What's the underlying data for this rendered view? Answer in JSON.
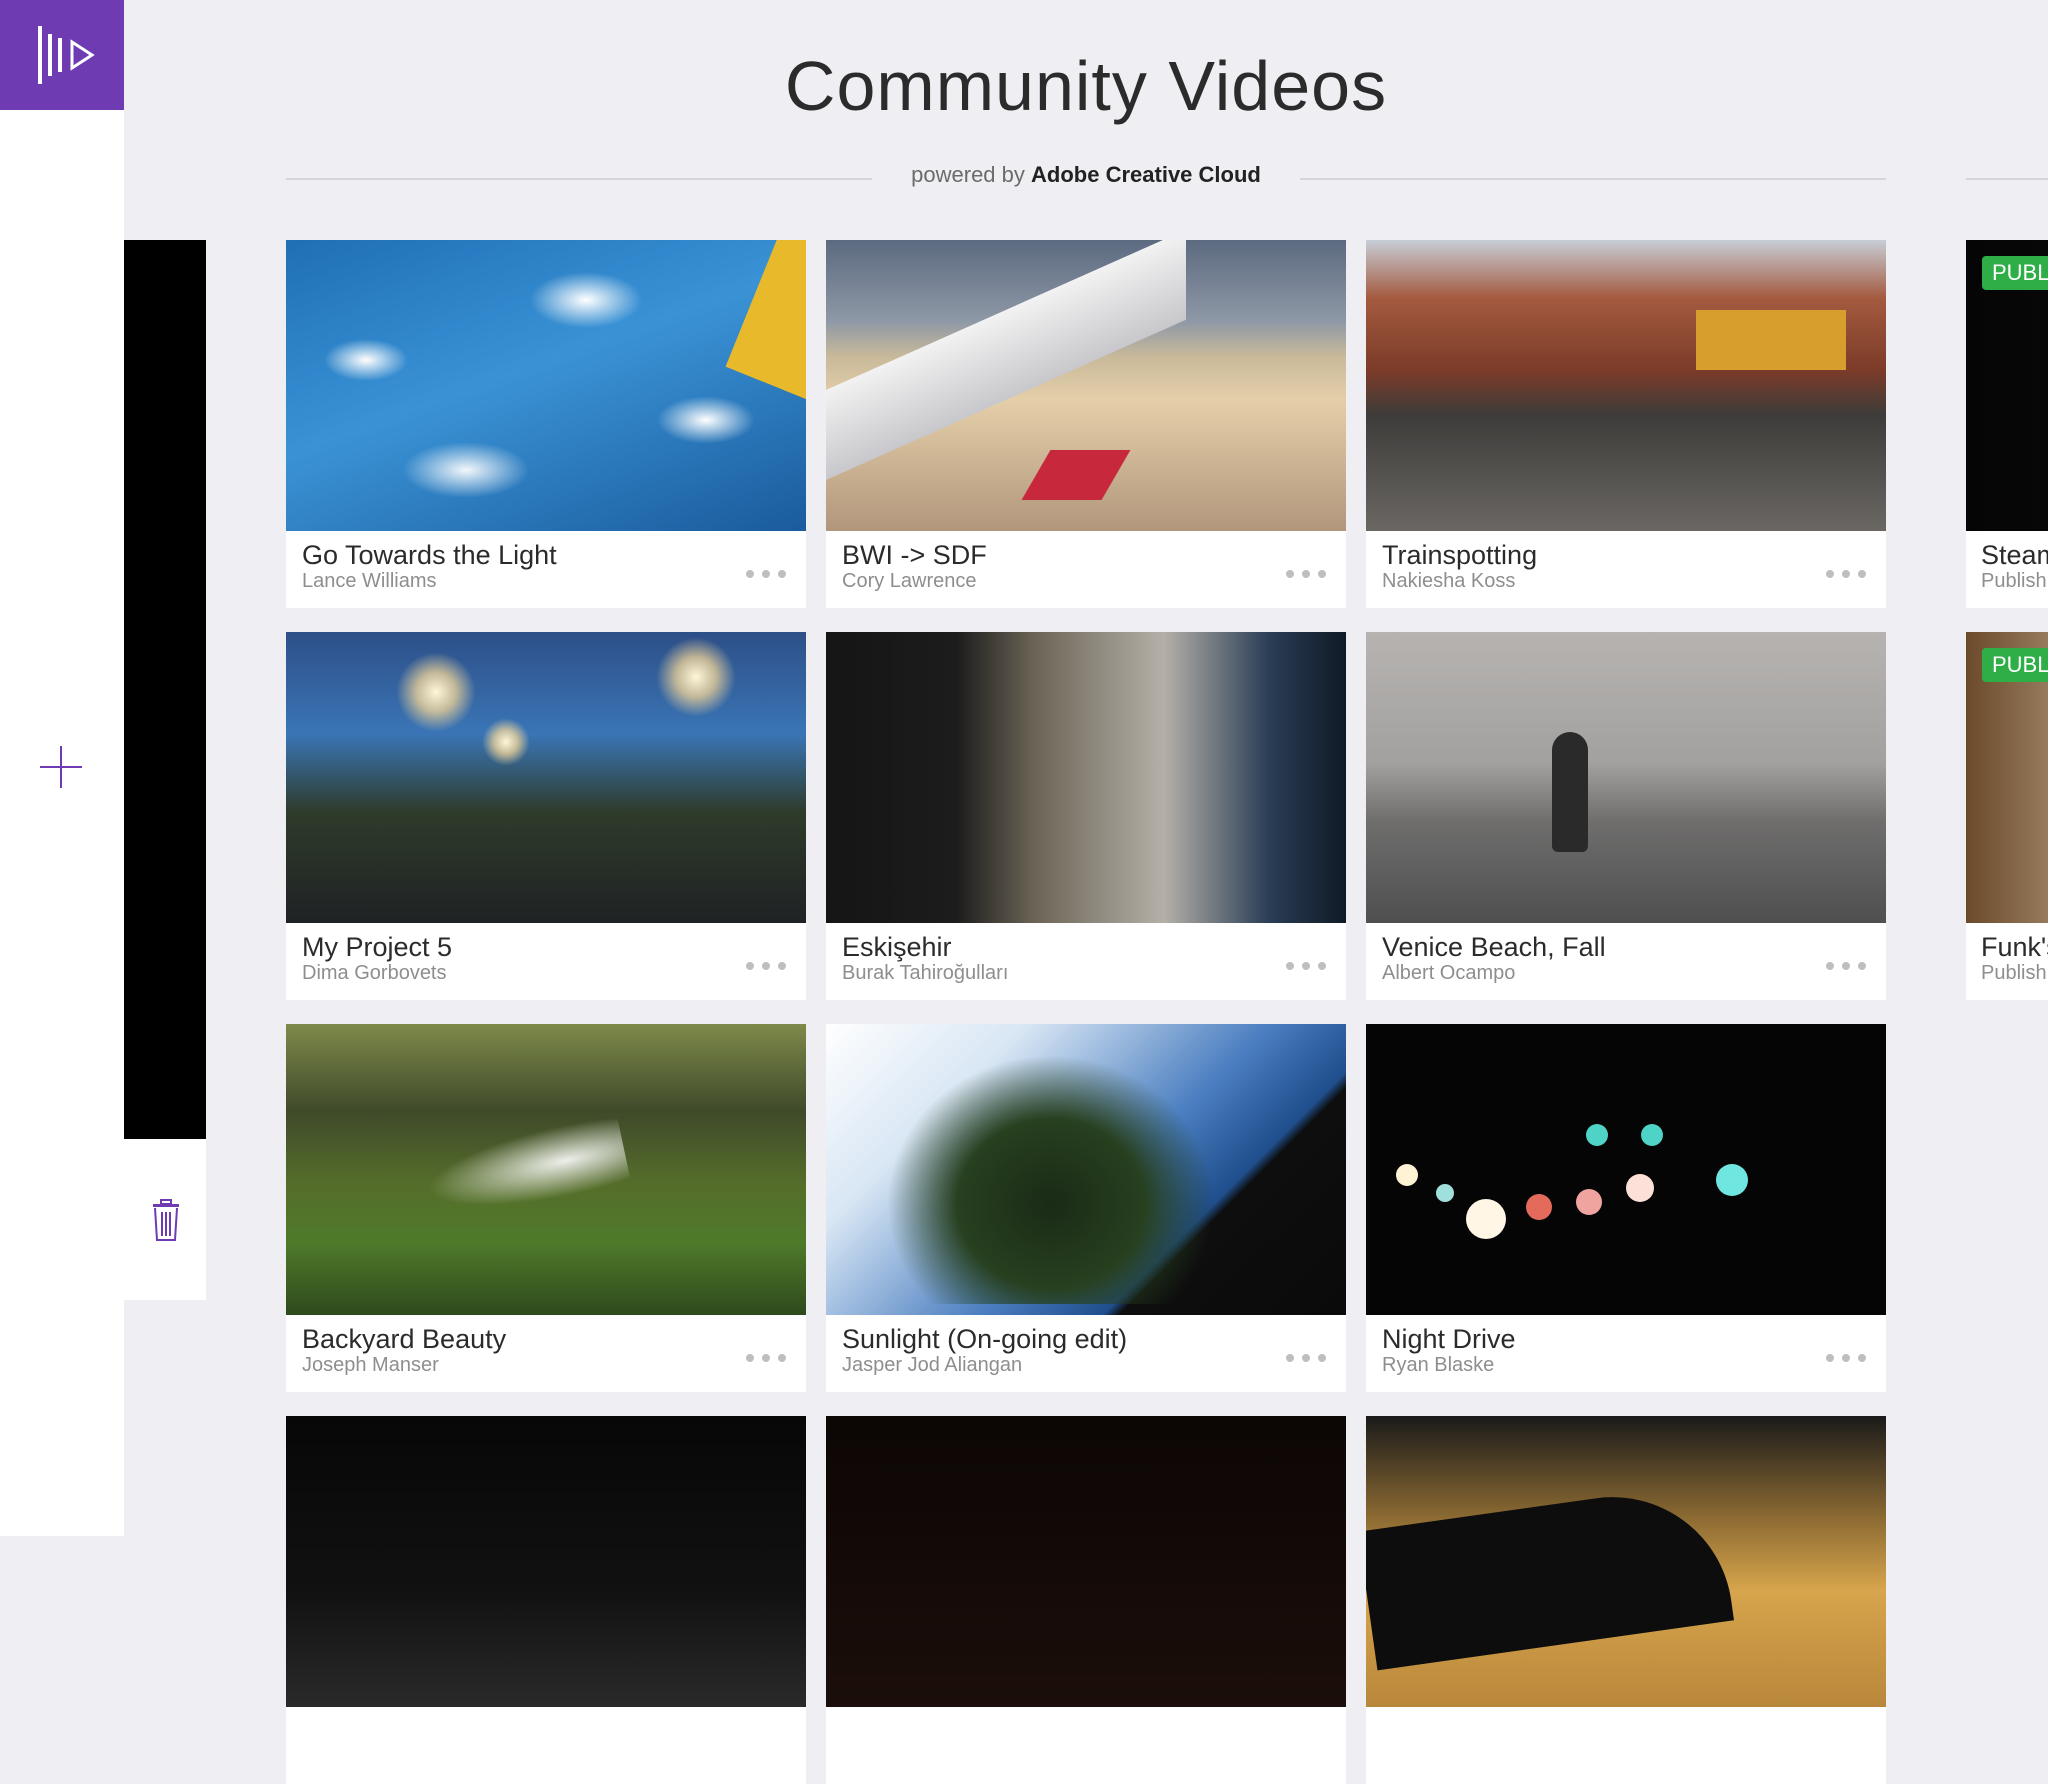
{
  "header": {
    "title": "Community Videos",
    "powered_prefix": "powered by",
    "powered_brand": "Adobe Creative Cloud"
  },
  "colors": {
    "accent": "#6e3bb3",
    "background": "#efeef3",
    "badge_green": "#2fae48"
  },
  "sidebar": {
    "logo_icon": "premiere-clip-logo-icon",
    "add_icon": "plus-icon",
    "trash_icon": "trash-icon"
  },
  "videos": [
    {
      "title": "Go Towards the Light",
      "author": "Lance Williams"
    },
    {
      "title": "BWI -> SDF",
      "author": "Cory Lawrence"
    },
    {
      "title": "Trainspotting",
      "author": "Nakiesha Koss"
    },
    {
      "title": "My Project 5",
      "author": "Dima Gorbovets"
    },
    {
      "title": "Eskişehir",
      "author": "Burak Tahiroğulları"
    },
    {
      "title": "Venice Beach, Fall",
      "author": "Albert Ocampo"
    },
    {
      "title": "Backyard Beauty",
      "author": "Joseph Manser"
    },
    {
      "title": "Sunlight (On-going edit)",
      "author": "Jasper Jod Aliangan"
    },
    {
      "title": "Night Drive",
      "author": "Ryan Blaske"
    }
  ],
  "side_cards": [
    {
      "badge": "PUBL",
      "title": "Steam",
      "subtitle": "Publish"
    },
    {
      "badge": "PUBL",
      "title": "Funk's",
      "subtitle": "Publish"
    }
  ],
  "more_icon": "more-dots-icon"
}
